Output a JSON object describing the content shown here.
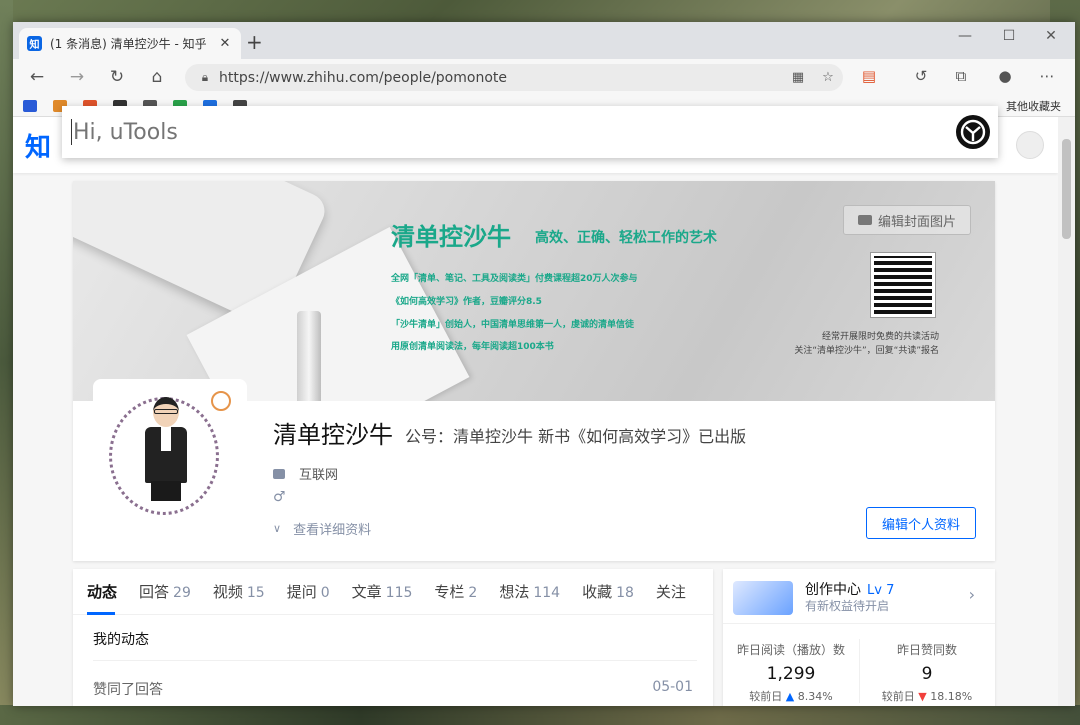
{
  "browser": {
    "tab_title": "(1 条消息) 清单控沙牛 - 知乎",
    "tab_favicon": "知",
    "url": "https://www.zhihu.com/people/pomonote",
    "bookmarks_other": "其他收藏夹"
  },
  "utools": {
    "placeholder": "Hi, uTools"
  },
  "zhihu": {
    "logo": "知"
  },
  "cover": {
    "title": "清单控沙牛",
    "subtitle": "高效、正确、轻松工作的艺术",
    "lines": [
      "全网「清单、笔记、工具及阅读类」付费课程超20万人次参与",
      "《如何高效学习》作者，豆瓣评分8.5",
      "「沙牛清单」创始人，中国清单思维第一人，虔诚的清单信徒",
      "用原创清单阅读法，每年阅读超100本书"
    ],
    "qr_note_1": "经常开展限时免费的共读活动",
    "qr_note_2": "关注“清单控沙牛”，回复“共读”报名",
    "edit_cover_label": "编辑封面图片"
  },
  "profile": {
    "name": "清单控沙牛",
    "headline": "公号：清单控沙牛 新书《如何高效学习》已出版",
    "industry": "互联网",
    "gender_symbol": "♂",
    "detail_link": "查看详细资料",
    "edit_profile_label": "编辑个人资料"
  },
  "tabs": [
    {
      "label": "动态",
      "count": ""
    },
    {
      "label": "回答",
      "count": "29"
    },
    {
      "label": "视频",
      "count": "15"
    },
    {
      "label": "提问",
      "count": "0"
    },
    {
      "label": "文章",
      "count": "115"
    },
    {
      "label": "专栏",
      "count": "2"
    },
    {
      "label": "想法",
      "count": "114"
    },
    {
      "label": "收藏",
      "count": "18"
    },
    {
      "label": "关注",
      "count": ""
    }
  ],
  "activity": {
    "section_title": "我的动态",
    "item_label": "赞同了回答",
    "item_date": "05-01"
  },
  "creator": {
    "title": "创作中心",
    "level": "Lv 7",
    "subtitle": "有新权益待开启",
    "stats": [
      {
        "label": "昨日阅读（播放）数",
        "value": "1,299",
        "delta_prefix": "较前日",
        "delta": "8.34%",
        "direction": "up"
      },
      {
        "label": "昨日赞同数",
        "value": "9",
        "delta_prefix": "较前日",
        "delta": "18.18%",
        "direction": "down"
      }
    ]
  },
  "colors": {
    "accent": "#0066ff",
    "cover_green": "#1aa88a",
    "down_red": "#f1403c"
  }
}
